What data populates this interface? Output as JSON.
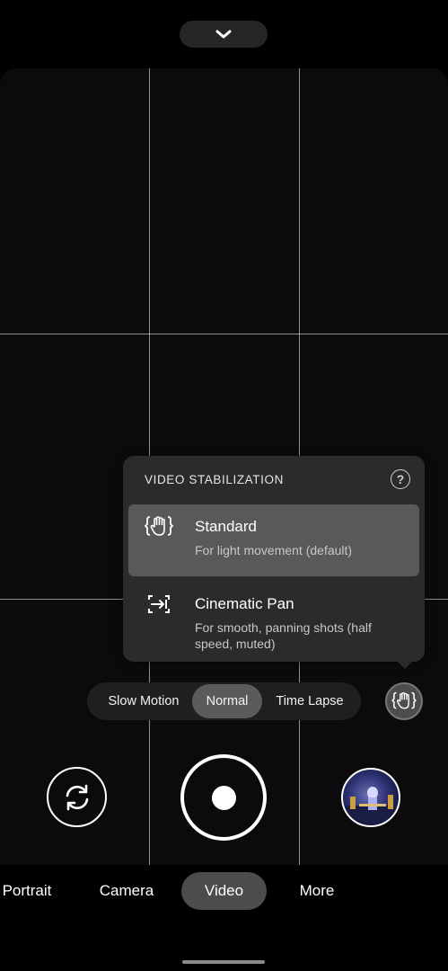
{
  "top": {
    "collapse_icon": "chevron-down-icon"
  },
  "stabilization": {
    "title": "VIDEO STABILIZATION",
    "help_icon": "help-circle-icon",
    "help_glyph": "?",
    "options": [
      {
        "name": "Standard",
        "description": "For light movement (default)",
        "icon": "hand-stabilization-icon",
        "selected": true
      },
      {
        "name": "Cinematic Pan",
        "description": "For smooth, panning shots (half speed, muted)",
        "icon": "pan-arrow-icon",
        "selected": false
      }
    ]
  },
  "speed_modes": {
    "items": [
      "Slow Motion",
      "Normal",
      "Time Lapse"
    ],
    "selected": "Normal"
  },
  "stabilization_button": {
    "icon": "hand-stabilization-icon"
  },
  "controls": {
    "switch_camera_icon": "switch-camera-icon",
    "shutter_icon": "record-icon",
    "gallery_thumbnail": "gallery-thumbnail"
  },
  "camera_modes": {
    "items": [
      "Portrait",
      "Camera",
      "Video",
      "More"
    ],
    "selected": "Video"
  },
  "colors": {
    "viewfinder": "#0d0a0d",
    "panel": "#2c2a2c",
    "selected_option": "#5a595a",
    "active_pill": "#5c5b5c"
  }
}
